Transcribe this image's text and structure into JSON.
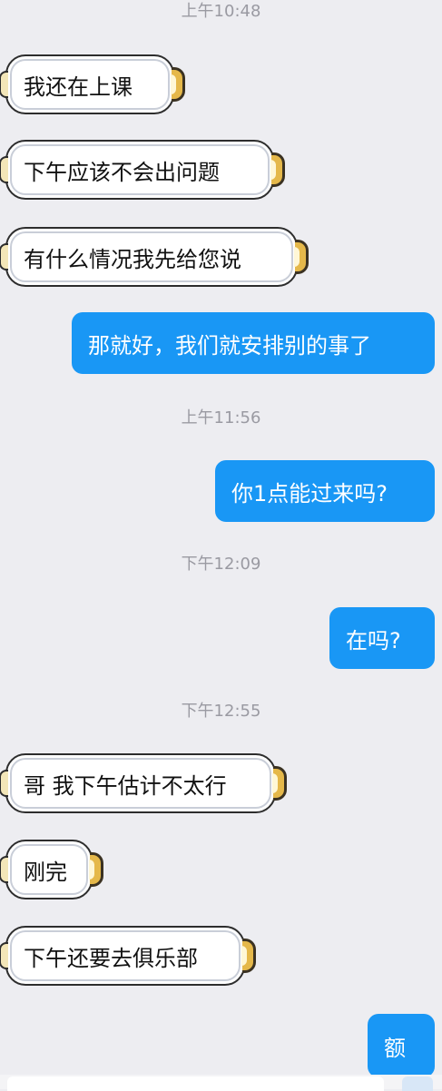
{
  "messages": {
    "ts1": "上午10:48",
    "m1": "我还在上课",
    "m2": "下午应该不会出问题",
    "m3": "有什么情况我先给您说",
    "m4": "那就好，我们就安排别的事了",
    "ts2": "上午11:56",
    "m5": "你1点能过来吗?",
    "ts3": "下午12:09",
    "m6": "在吗?",
    "ts4": "下午12:55",
    "m7": "哥 我下午估计不太行",
    "m8": "刚完",
    "m9": "下午还要去俱乐部",
    "m10": "额"
  },
  "colors": {
    "background": "#ededf1",
    "outgoing_bubble": "#1997f5",
    "incoming_bubble": "#ffffff",
    "timestamp": "#9a9aa2"
  }
}
